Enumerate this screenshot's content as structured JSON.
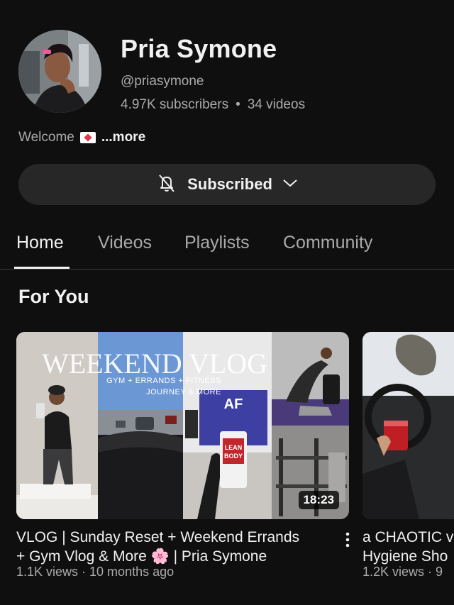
{
  "channel": {
    "name": "Pria Symone",
    "handle": "@priasymone",
    "subscribers": "4.97K subscribers",
    "separator": "•",
    "videos": "34 videos"
  },
  "description": {
    "text": "Welcome",
    "more": "...more"
  },
  "subscribe_button": {
    "label": "Subscribed",
    "icon": "bell-off-icon",
    "chevron": "chevron-down-icon"
  },
  "tabs": [
    {
      "label": "Home",
      "active": true
    },
    {
      "label": "Videos",
      "active": false
    },
    {
      "label": "Playlists",
      "active": false
    },
    {
      "label": "Community",
      "active": false
    }
  ],
  "section": {
    "title": "For You"
  },
  "videos": [
    {
      "thumbnail_text_title": "WEEKEND VLOG",
      "thumbnail_text_sub1": "GYM + ERRANDS + FITNESS",
      "thumbnail_text_sub2": "JOURNEY & MORE",
      "thumbnail_logo": "AF",
      "thumbnail_product": "LEAN BODY",
      "duration": "18:23",
      "title_line1": "VLOG | Sunday Reset + Weekend Errands",
      "title_line2": "+ Gym Vlog & More 🌸 | Pria Symone",
      "meta": "1.1K views · 10 months ago"
    },
    {
      "title_line1": "a CHAOTIC v",
      "title_line2": "Hygiene Sho",
      "meta": "1.2K views · 9"
    }
  ],
  "colors": {
    "background": "#0f0f0f",
    "secondary_text": "#aaaaaa",
    "button_bg": "#272727"
  }
}
